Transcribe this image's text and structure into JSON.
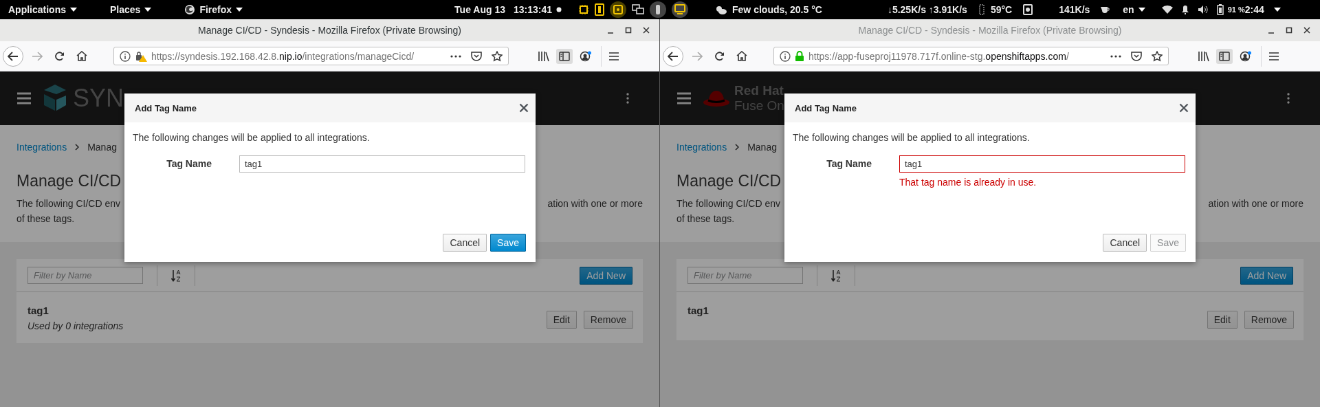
{
  "top_bar": {
    "menus": [
      {
        "label": "Applications",
        "kind": "plain"
      },
      {
        "label": "Places",
        "kind": "plain"
      },
      {
        "label": "Firefox",
        "kind": "app"
      }
    ],
    "clock": {
      "date": "Tue Aug 13",
      "time": "13:13:41"
    },
    "weather": "Few clouds, 20.5 °C",
    "network": "↓5.25K/s ↑3.91K/s",
    "cpu_temp": "59°C",
    "disk_rate": "141K/s",
    "language": "en",
    "battery": "91 %",
    "time_left": "2:44"
  },
  "windows": [
    {
      "title": "Manage CI/CD - Syndesis - Mozilla Firefox (Private Browsing)",
      "active": true,
      "url": {
        "kind": "warning",
        "parts": [
          {
            "text": "https://syndesis.192.168.42.8.",
            "strong": false
          },
          {
            "text": "nip.io",
            "strong": true
          },
          {
            "text": "/integrations/manageCicd/",
            "strong": false
          }
        ]
      },
      "brand": {
        "kind": "syndesis",
        "lines": [
          "SYN"
        ]
      },
      "breadcrumb": [
        {
          "label": "Integrations",
          "link": true
        },
        {
          "label": "Manag",
          "link": false
        }
      ],
      "heading": "Manage CI/CD",
      "description": {
        "start": "The following CI/CD env",
        "end": "ation with one or more",
        "continued": "of these tags."
      },
      "filter": {
        "placeholder": "Filter by Name"
      },
      "add_button": "Add New",
      "tags": [
        {
          "name": "tag1",
          "usage": "Used by 0 integrations",
          "actions": [
            "Edit",
            "Remove"
          ]
        }
      ],
      "modal": {
        "title": "Add Tag Name",
        "message": "The following changes will be applied to all integrations.",
        "field": {
          "label": "Tag Name",
          "value": "tag1",
          "invalid": false
        },
        "buttons": [
          {
            "label": "Cancel",
            "kind": "default",
            "disabled": false
          },
          {
            "label": "Save",
            "kind": "primary",
            "disabled": false
          }
        ]
      }
    },
    {
      "title": "Manage CI/CD - Syndesis - Mozilla Firefox (Private Browsing)",
      "active": false,
      "url": {
        "kind": "secure",
        "parts": [
          {
            "text": "https://app-fuseproj11978.717f.online-stg.",
            "strong": false
          },
          {
            "text": "openshiftapps.com",
            "strong": true
          },
          {
            "text": "/",
            "strong": false
          }
        ]
      },
      "brand": {
        "kind": "redhat",
        "lines": [
          "Red Hat",
          "Fuse On"
        ]
      },
      "breadcrumb": [
        {
          "label": "Integrations",
          "link": true
        },
        {
          "label": "Manag",
          "link": false
        }
      ],
      "heading": "Manage CI/CD",
      "description": {
        "start": "The following CI/CD env",
        "end": "ation with one or more",
        "continued": "of these tags."
      },
      "filter": {
        "placeholder": "Filter by Name"
      },
      "add_button": "Add New",
      "tags": [
        {
          "name": "tag1",
          "actions": [
            "Edit",
            "Remove"
          ]
        }
      ],
      "modal": {
        "title": "Add Tag Name",
        "message": "The following changes will be applied to all integrations.",
        "field": {
          "label": "Tag Name",
          "value": "tag1",
          "invalid": true
        },
        "error": "That tag name is already in use.",
        "buttons": [
          {
            "label": "Cancel",
            "kind": "default",
            "disabled": false
          },
          {
            "label": "Save",
            "kind": "primary",
            "disabled": true
          }
        ]
      }
    }
  ]
}
